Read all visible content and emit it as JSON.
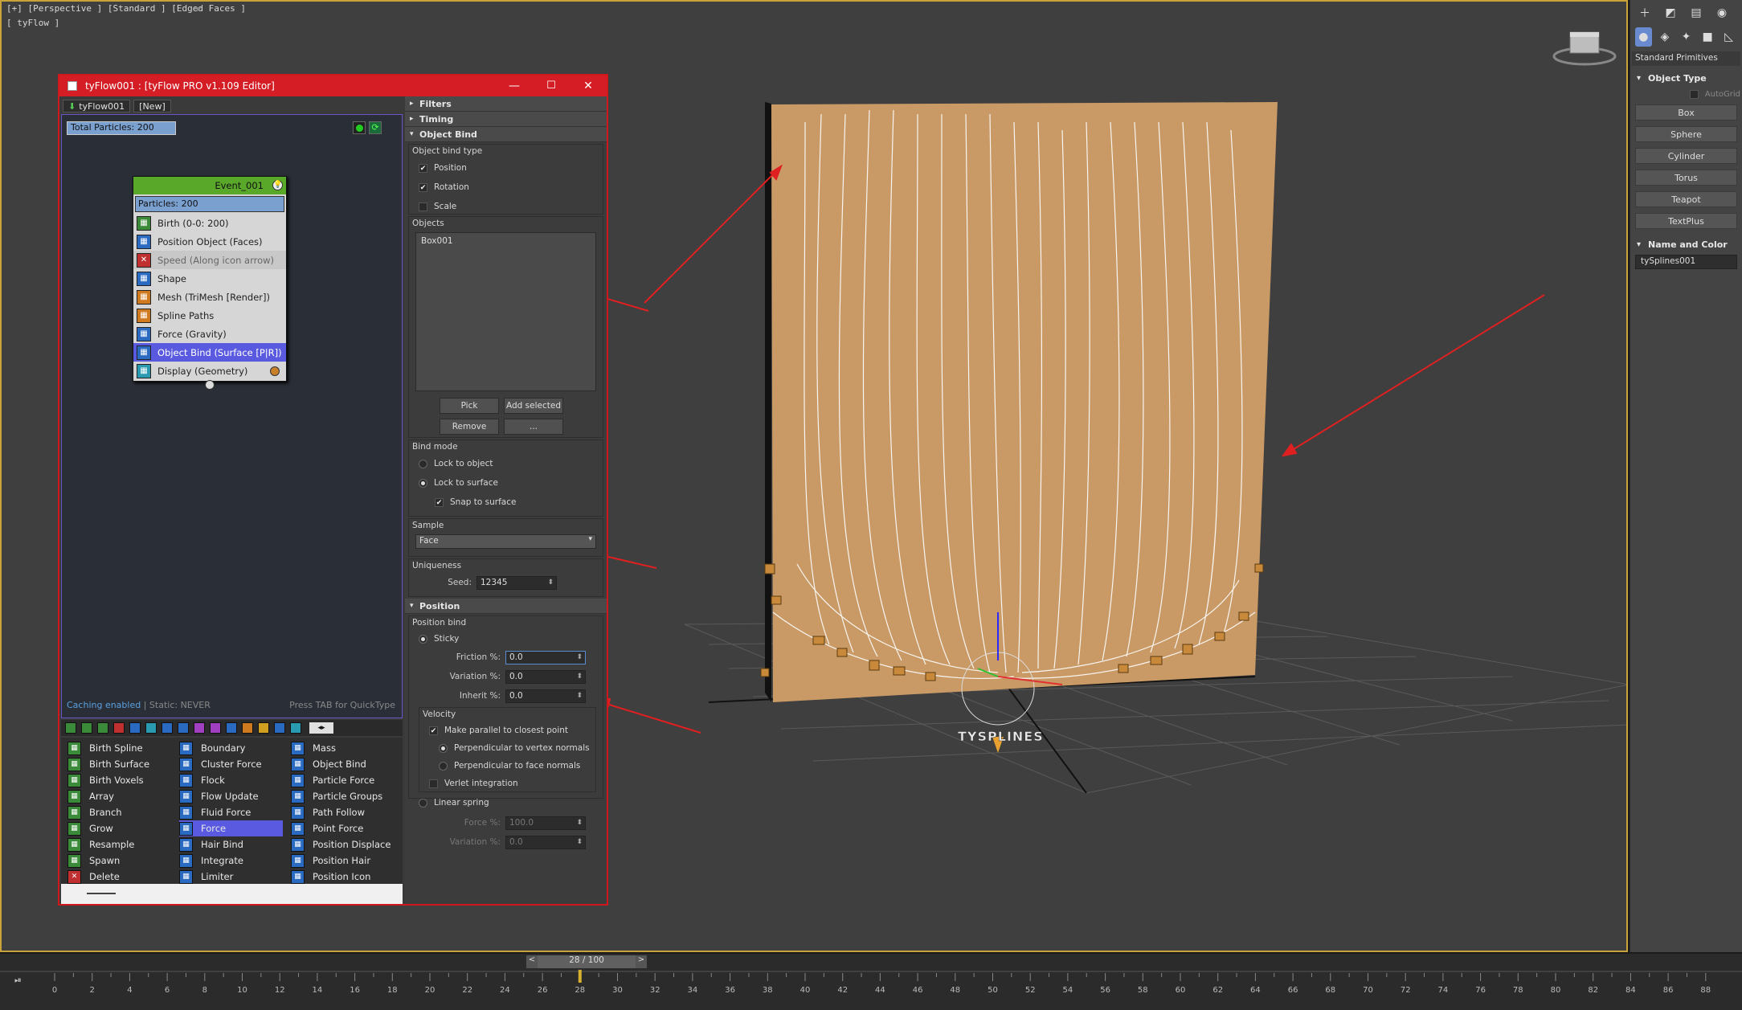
{
  "viewport": {
    "label": "[+] [Perspective ] [Standard ] [Edged Faces ]",
    "sub_label": "[ tyFlow ]",
    "watermark": "TYSPLINES"
  },
  "tyflow": {
    "title": "tyFlow001 : [tyFlow PRO v1.109 Editor]",
    "tabs": [
      "tyFlow001",
      "[New]"
    ],
    "total_particles": "Total Particles: 200",
    "event": {
      "name": "Event_001",
      "particles": "Particles: 200",
      "operators": [
        {
          "label": "Birth (0-0: 200)",
          "color": "#3a8a3a",
          "icon": "birth-icon"
        },
        {
          "label": "Position Object (Faces)",
          "color": "#2a6ac0",
          "icon": "position-icon"
        },
        {
          "label": "Speed (Along icon arrow)",
          "color": "#c03030",
          "icon": "speed-icon",
          "disabled": true
        },
        {
          "label": "Shape",
          "color": "#2a6ac0",
          "icon": "shape-icon"
        },
        {
          "label": "Mesh (TriMesh [Render])",
          "color": "#d07a20",
          "icon": "mesh-icon"
        },
        {
          "label": "Spline Paths",
          "color": "#d07a20",
          "icon": "spline-icon"
        },
        {
          "label": "Force (Gravity)",
          "color": "#2a6ac0",
          "icon": "force-icon"
        },
        {
          "label": "Object Bind (Surface [P|R])",
          "color": "#2a6ac0",
          "icon": "object-bind-icon",
          "selected": true
        },
        {
          "label": "Display (Geometry)",
          "color": "#2a9ab0",
          "icon": "display-icon"
        }
      ]
    },
    "caching": "Caching enabled",
    "static": " | Static: NEVER",
    "quicktype": "Press TAB for QuickType",
    "operator_columns": [
      [
        {
          "label": "Birth Spline",
          "color": "#3a8a3a"
        },
        {
          "label": "Birth Surface",
          "color": "#3a8a3a"
        },
        {
          "label": "Birth Voxels",
          "color": "#3a8a3a"
        },
        {
          "label": "Array",
          "color": "#3a8a3a"
        },
        {
          "label": "Branch",
          "color": "#3a8a3a"
        },
        {
          "label": "Grow",
          "color": "#3a8a3a"
        },
        {
          "label": "Resample",
          "color": "#3a8a3a"
        },
        {
          "label": "Spawn",
          "color": "#3a8a3a"
        },
        {
          "label": "Delete",
          "color": "#c03030"
        }
      ],
      [
        {
          "label": "Boundary",
          "color": "#2a6ac0"
        },
        {
          "label": "Cluster Force",
          "color": "#2a6ac0"
        },
        {
          "label": "Flock",
          "color": "#2a6ac0"
        },
        {
          "label": "Flow Update",
          "color": "#2a6ac0"
        },
        {
          "label": "Fluid Force",
          "color": "#2a6ac0"
        },
        {
          "label": "Force",
          "color": "#2a6ac0",
          "selected": true
        },
        {
          "label": "Hair Bind",
          "color": "#2a6ac0"
        },
        {
          "label": "Integrate",
          "color": "#2a6ac0"
        },
        {
          "label": "Limiter",
          "color": "#2a6ac0"
        }
      ],
      [
        {
          "label": "Mass",
          "color": "#2a6ac0"
        },
        {
          "label": "Object Bind",
          "color": "#2a6ac0"
        },
        {
          "label": "Particle Force",
          "color": "#2a6ac0"
        },
        {
          "label": "Particle Groups",
          "color": "#2a6ac0"
        },
        {
          "label": "Path Follow",
          "color": "#2a6ac0"
        },
        {
          "label": "Point Force",
          "color": "#2a6ac0"
        },
        {
          "label": "Position Displace",
          "color": "#2a6ac0"
        },
        {
          "label": "Position Hair",
          "color": "#2a6ac0"
        },
        {
          "label": "Position Icon",
          "color": "#2a6ac0"
        }
      ]
    ]
  },
  "props": {
    "filters": "Filters",
    "timing": "Timing",
    "object_bind": "Object Bind",
    "object_bind_type": "Object bind type",
    "position": "Position",
    "rotation": "Rotation",
    "scale": "Scale",
    "objects": "Objects",
    "object_item": "Box001",
    "pick": "Pick",
    "add_selected": "Add selected",
    "remove": "Remove",
    "more": "...",
    "bind_mode": "Bind mode",
    "lock_to_object": "Lock to object",
    "lock_to_surface": "Lock to surface",
    "snap_to_surface": "Snap to surface",
    "sample": "Sample",
    "sample_value": "Face",
    "uniqueness": "Uniqueness",
    "seed_label": "Seed:",
    "seed_value": "12345",
    "position_rollout": "Position",
    "position_bind": "Position bind",
    "sticky": "Sticky",
    "friction_label": "Friction %:",
    "friction_value": "0.0",
    "variation_label": "Variation %:",
    "variation_value": "0.0",
    "inherit_label": "Inherit %:",
    "inherit_value": "0.0",
    "velocity": "Velocity",
    "make_parallel": "Make parallel to closest point",
    "perp_vertex": "Perpendicular to vertex normals",
    "perp_face": "Perpendicular to face normals",
    "verlet": "Verlet integration",
    "linear_spring": "Linear spring",
    "force_label": "Force %:",
    "force_value": "100.0",
    "variation2_label": "Variation %:",
    "variation2_value": "0.0"
  },
  "cmdpanel": {
    "category": "Standard Primitives",
    "object_type": "Object Type",
    "autogrid": "AutoGrid",
    "buttons": [
      "Box",
      "Sphere",
      "Cylinder",
      "Torus",
      "Teapot",
      "TextPlus"
    ],
    "name_and_color": "Name and Color",
    "name_value": "tySplines001"
  },
  "timeline": {
    "frame": "28 / 100",
    "ticks": [
      "0",
      "2",
      "4",
      "6",
      "8",
      "10",
      "12",
      "14",
      "16",
      "18",
      "20",
      "22",
      "24",
      "26",
      "28",
      "30",
      "32",
      "34",
      "36",
      "38",
      "40",
      "42",
      "44",
      "46",
      "48",
      "50",
      "52",
      "54",
      "56",
      "58",
      "60",
      "62",
      "64",
      "66",
      "68",
      "70",
      "72",
      "74",
      "76",
      "78",
      "80",
      "82",
      "84",
      "86",
      "88"
    ],
    "current": 28,
    "max": 100
  },
  "colors": {
    "accent_red": "#d41d24",
    "selection": "#5a5ae0",
    "event_green": "#5aa82a",
    "box_orange": "#c99a66"
  }
}
